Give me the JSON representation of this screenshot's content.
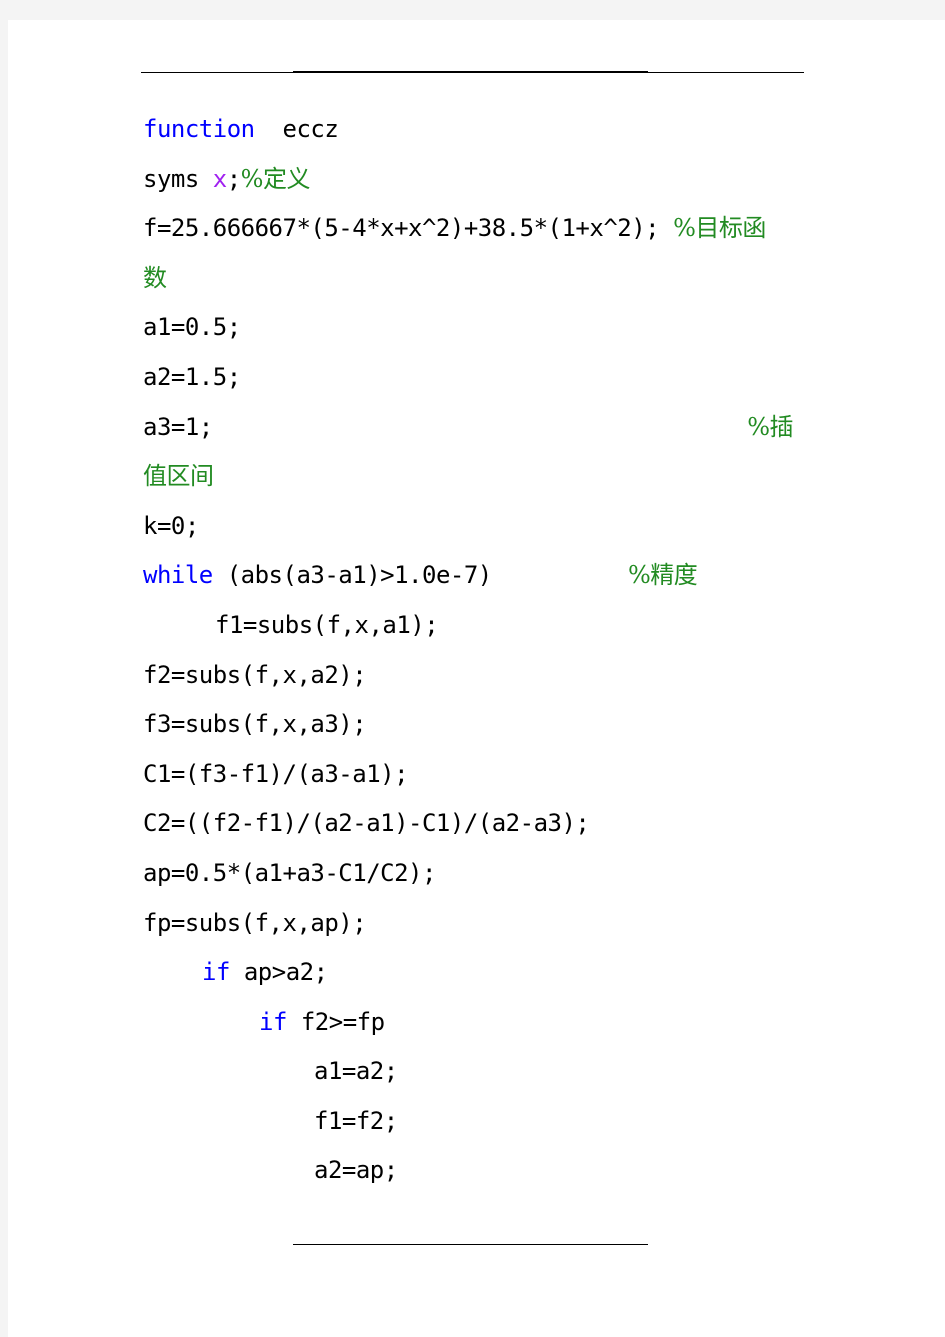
{
  "document": {
    "language": "MATLAB",
    "colors": {
      "keyword": "#0000ff",
      "symbolic_variable": "#a020f0",
      "comment": "#228b22",
      "text": "#000000",
      "page_background": "#ffffff",
      "outer_background": "#f4f4f4"
    },
    "lines": [
      {
        "kw": "function",
        "text": "  eccz"
      },
      {
        "text": "syms ",
        "var": "x",
        "text2": ";",
        "comment": "%定义"
      },
      {
        "text": "f=25.666667*(5-4*x+x^2)+38.5*(1+x^2); ",
        "comment": "%目标函"
      },
      {
        "comment": "数"
      },
      {
        "text": "a1=0.5;"
      },
      {
        "text": "a2=1.5;"
      },
      {
        "text": "a3=1;",
        "comment": "%插"
      },
      {
        "comment": "值区间"
      },
      {
        "text": "k=0;"
      },
      {
        "kw": "while",
        "text": " (abs(a3-a1)>1.0e-7)",
        "comment": "%精度"
      },
      {
        "text": "f1=subs(f,x,a1);"
      },
      {
        "text": "f2=subs(f,x,a2);"
      },
      {
        "text": "f3=subs(f,x,a3);"
      },
      {
        "text": "C1=(f3-f1)/(a3-a1);"
      },
      {
        "text": "C2=((f2-f1)/(a2-a1)-C1)/(a2-a3);"
      },
      {
        "text": "ap=0.5*(a1+a3-C1/C2);"
      },
      {
        "text": "fp=subs(f,x,ap);"
      },
      {
        "kw": "if",
        "text": " ap>a2;"
      },
      {
        "kw": "if",
        "text": " f2>=fp"
      },
      {
        "text": "a1=a2;"
      },
      {
        "text": "f1=f2;"
      },
      {
        "text": "a2=ap;"
      }
    ]
  }
}
